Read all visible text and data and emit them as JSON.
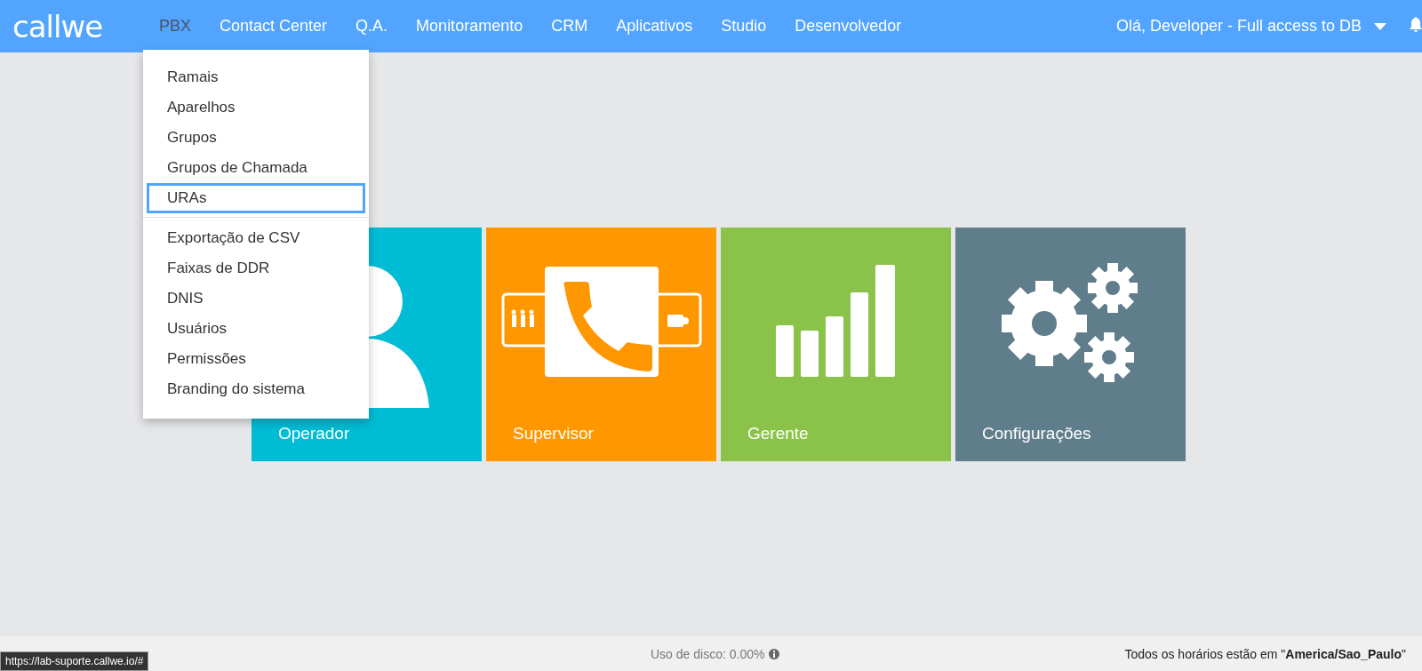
{
  "logo": "callwe",
  "nav": [
    {
      "label": "PBX",
      "selected": true
    },
    {
      "label": "Contact Center",
      "selected": false
    },
    {
      "label": "Q.A.",
      "selected": false
    },
    {
      "label": "Monitoramento",
      "selected": false
    },
    {
      "label": "CRM",
      "selected": false
    },
    {
      "label": "Aplicativos",
      "selected": false
    },
    {
      "label": "Studio",
      "selected": false
    },
    {
      "label": "Desenvolvedor",
      "selected": false
    }
  ],
  "user_menu": "Olá, Developer - Full access to DB",
  "dropdown": {
    "groups": [
      [
        {
          "label": "Ramais",
          "selected": false
        },
        {
          "label": "Aparelhos",
          "selected": false
        },
        {
          "label": "Grupos",
          "selected": false
        },
        {
          "label": "Grupos de Chamada",
          "selected": false
        },
        {
          "label": "URAs",
          "selected": true
        }
      ],
      [
        {
          "label": "Exportação de CSV",
          "selected": false
        },
        {
          "label": "Faixas de DDR",
          "selected": false
        },
        {
          "label": "DNIS",
          "selected": false
        },
        {
          "label": "Usuários",
          "selected": false
        },
        {
          "label": "Permissões",
          "selected": false
        },
        {
          "label": "Branding do sistema",
          "selected": false
        }
      ]
    ]
  },
  "tiles": [
    {
      "label": "Operador",
      "kind": "operator",
      "color": "#00bcd4"
    },
    {
      "label": "Supervisor",
      "kind": "supervisor",
      "color": "#ff9800"
    },
    {
      "label": "Gerente",
      "kind": "manager",
      "color": "#8bc34a"
    },
    {
      "label": "Configurações",
      "kind": "settings",
      "color": "#607d8b"
    }
  ],
  "footer": {
    "disk_usage": "Uso de disco: 0.00%",
    "timezone": "Todos os horários estão em \"**America/Sao_Paulo**\""
  },
  "status_url": "https://lab-suporte.callwe.io/#"
}
